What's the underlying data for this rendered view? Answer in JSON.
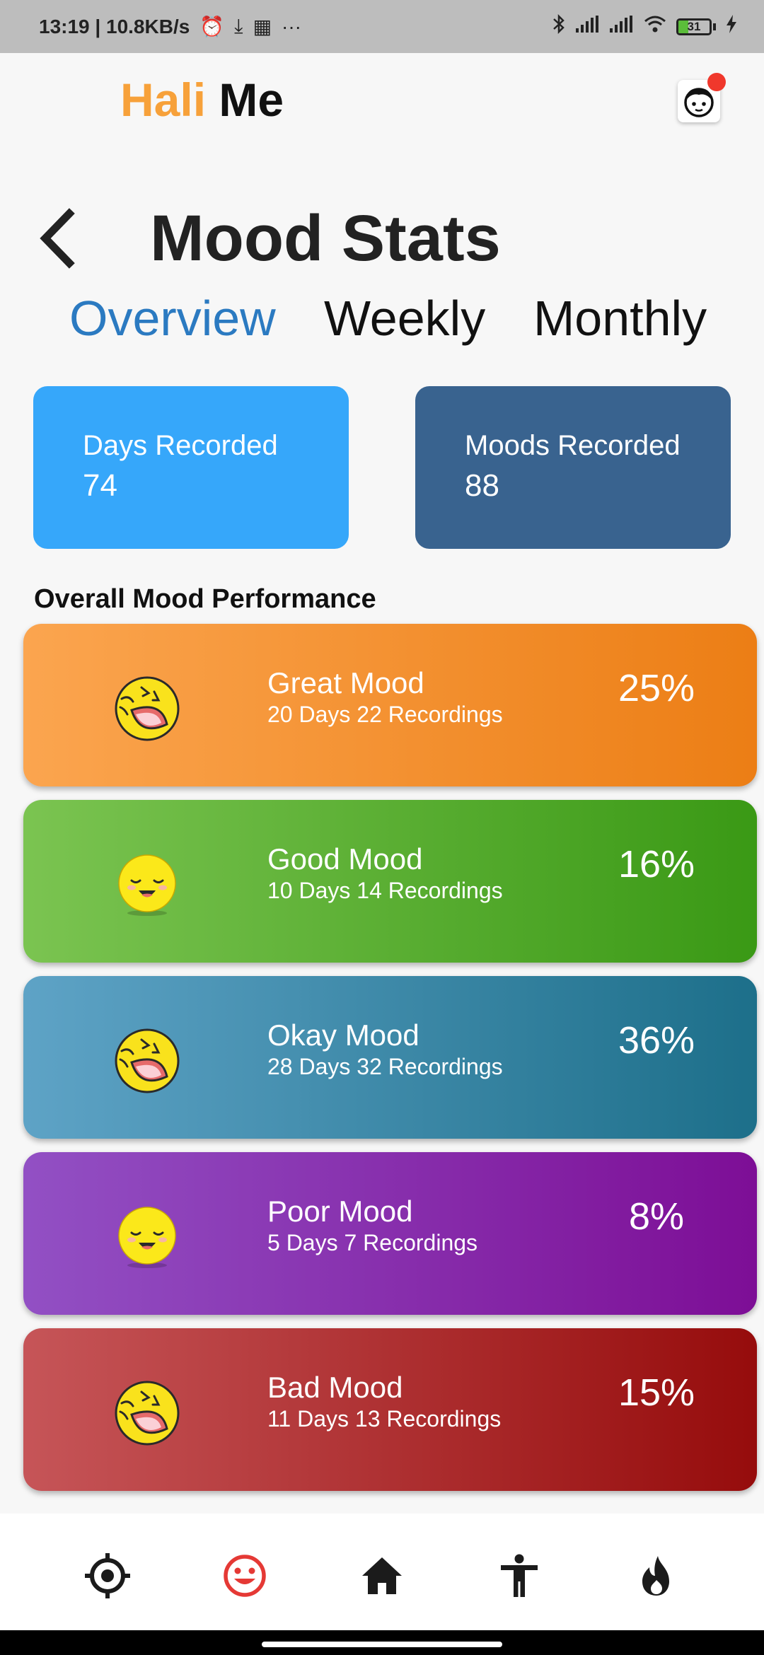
{
  "status_bar": {
    "time_speed": "13:19 | 10.8KB/s",
    "more": "···",
    "battery": "31",
    "battery_level": 0.31
  },
  "header": {
    "logo_part1": "Hali",
    "logo_part2": "Me",
    "accent": "#f7a13a"
  },
  "page": {
    "title": "Mood Stats"
  },
  "tabs": [
    {
      "label": "Overview",
      "active": true
    },
    {
      "label": "Weekly",
      "active": false
    },
    {
      "label": "Monthly",
      "active": false
    }
  ],
  "stats": {
    "days": {
      "label": "Days Recorded",
      "value": "74",
      "color": "#36a7fa"
    },
    "moods": {
      "label": "Moods Recorded",
      "value": "88",
      "color": "#39638f"
    }
  },
  "section_title": "Overall Mood Performance",
  "moods": [
    {
      "name": "Great Mood",
      "sub": "20 Days 22 Recordings",
      "pct": "25%",
      "emoji": "laughing-emoji-icon",
      "color_from": "#fba54f",
      "color_to": "#ec7e15"
    },
    {
      "name": "Good Mood",
      "sub": "10 Days 14 Recordings",
      "pct": "16%",
      "emoji": "smiling-emoji-icon",
      "color_from": "#7bc451",
      "color_to": "#3a9915"
    },
    {
      "name": "Okay Mood",
      "sub": "28 Days 32 Recordings",
      "pct": "36%",
      "emoji": "laughing-emoji-icon",
      "color_from": "#5ea3c6",
      "color_to": "#1d6f8a"
    },
    {
      "name": "Poor Mood",
      "sub": "5 Days 7 Recordings",
      "pct": "8%",
      "emoji": "smiling-emoji-icon",
      "color_from": "#9250c4",
      "color_to": "#7d0e96"
    },
    {
      "name": "Bad Mood",
      "sub": "11 Days 13 Recordings",
      "pct": "15%",
      "emoji": "laughing-emoji-icon",
      "color_from": "#c65558",
      "color_to": "#960c0c"
    }
  ],
  "bottom_nav": [
    {
      "icon": "crosshair-icon",
      "active": false
    },
    {
      "icon": "smiley-icon",
      "active": true
    },
    {
      "icon": "home-icon",
      "active": false
    },
    {
      "icon": "person-icon",
      "active": false
    },
    {
      "icon": "flame-icon",
      "active": false
    }
  ],
  "colors": {
    "tab_active": "#2b7ac1",
    "nav_active": "#e53935",
    "nav_inactive": "#1b1b1b"
  }
}
